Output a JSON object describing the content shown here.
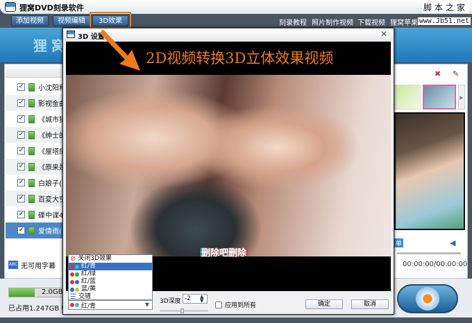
{
  "app": {
    "title": "狸窝DVD刻录软件",
    "watermark": "脚本之家",
    "watermark_url": "www.Jb51.net",
    "banner": "狸窝"
  },
  "toolbar": {
    "add_video": "添加视频",
    "edit_video": "视频编辑",
    "effect_3d": "3D效果",
    "links": [
      "刻录教程",
      "照片制作视频",
      "下载视频",
      "狸窝苹果"
    ]
  },
  "list": {
    "items": [
      "小沈阳和",
      "影视金曲",
      "《城市猎",
      "《绅士的",
      "《屋塔房",
      "《原来是",
      "白娘子(",
      "百変大空",
      "碟中谍4",
      "爱情雨("
    ],
    "selected_index": 9
  },
  "subtitle": "无可用字幕",
  "disk": {
    "capacity": "2.0GB",
    "used": "已占用1.247GB 中",
    "used_fraction": 0.62
  },
  "player": {
    "time": "00:00:00/00:00:00",
    "playlist_tab": "单"
  },
  "dialog": {
    "title": "3D 设置",
    "video_title": "2D视频转换3D立体效果视频",
    "caption": "删除吧删除",
    "mode_options": [
      "关闭3D效果",
      "红/青",
      "红/绿",
      "红/蓝",
      "蓝/黄",
      "交错"
    ],
    "selected_mode": "红/青",
    "depth_label": "3D深度",
    "depth_value": "-2",
    "apply_all": "应用到所有",
    "ok": "确定",
    "cancel": "取消"
  },
  "colors": {
    "accent": "#f07a1a",
    "selection": "#3a72c2"
  }
}
